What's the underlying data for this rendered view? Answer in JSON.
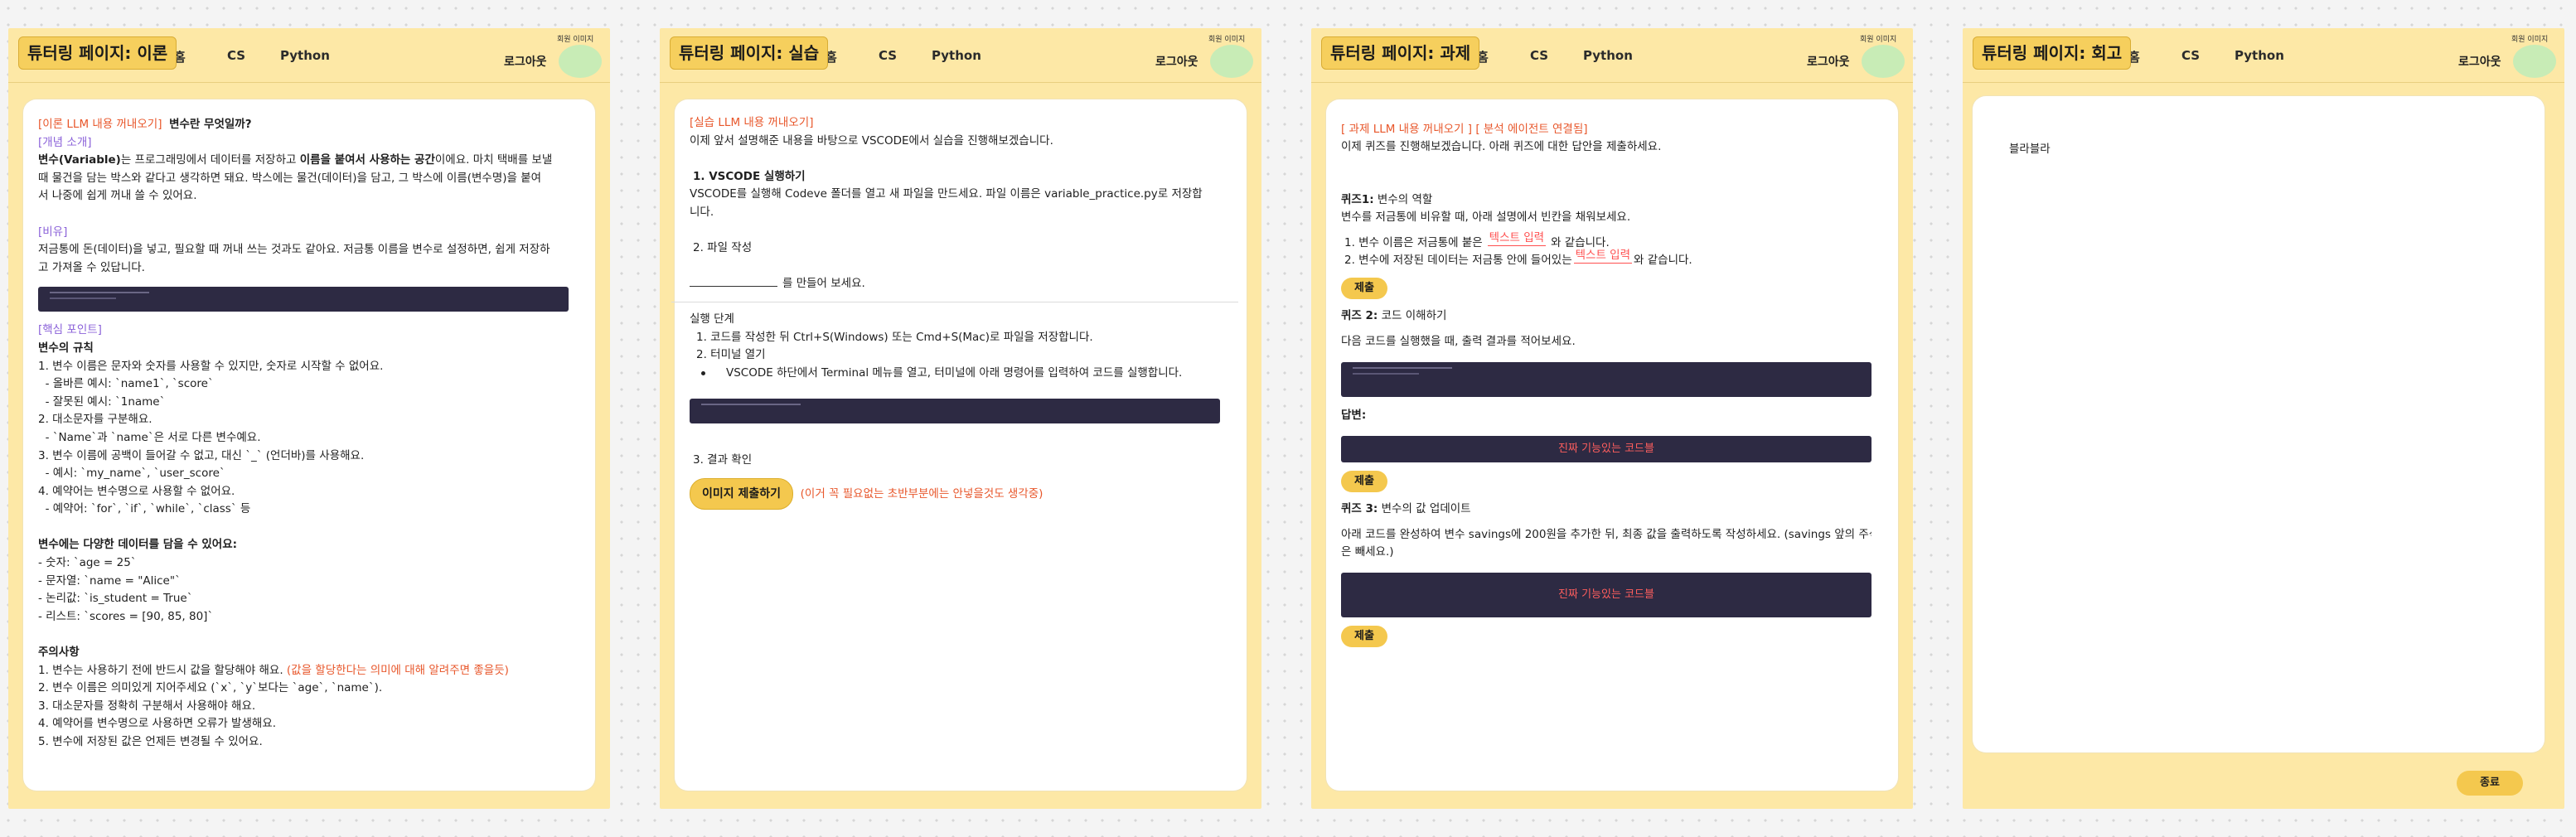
{
  "nav": {
    "stub": "홈",
    "cs": "CS",
    "python": "Python",
    "logout": "로그아웃",
    "avatar_label": "회원 이미지"
  },
  "pages": {
    "theory": {
      "title": "튜터링 페이지: 이론",
      "lines": {
        "l1a": "[이론 LLM 내용 꺼내오기]",
        "l1b": "변수란 무엇일까?",
        "l2": "[개념 소개]",
        "l3a": "변수(Variable)",
        "l3b": "는 프로그래밍에서 데이터를 저장하고 ",
        "l3c": "이름을 붙여서 사용하는 공간",
        "l3d": "이에요. 마치 택배를 보낼",
        "l4": "때 물건을 담는 박스와 같다고 생각하면 돼요. 박스에는 물건(데이터)을 담고, 그 박스에 이름(변수명)을 붙여",
        "l5": "서 나중에 쉽게 꺼내 쓸 수 있어요.",
        "l6": "[비유]",
        "l7": "저금통에 돈(데이터)을 넣고, 필요할 때 꺼내 쓰는 것과도 같아요. 저금통 이름을 변수로 설정하면, 쉽게 저장하",
        "l8": "고 가져올 수 있답니다.",
        "l9": "[핵심 포인트]",
        "l10": "변수의 규칙",
        "l11": "1. 변수 이름은 문자와 숫자를 사용할 수 있지만, 숫자로 시작할 수 없어요.",
        "l12": "  - 올바른 예시: `name1`, `score`",
        "l13": "  - 잘못된 예시: `1name`",
        "l14": "2. 대소문자를 구분해요.",
        "l15": "  - `Name`과 `name`은 서로 다른 변수예요.",
        "l16": "3. 변수 이름에 공백이 들어갈 수 없고, 대신 `_` (언더바)를 사용해요.",
        "l17": "  - 예시: `my_name`, `user_score`",
        "l18": "4. 예약어는 변수명으로 사용할 수 없어요.",
        "l19": "  - 예약어: `for`, `if`, `while`, `class` 등",
        "l20": "변수에는 다양한 데이터를 담을 수 있어요:",
        "l21": "- 숫자: `age = 25`",
        "l22": "- 문자열: `name = \"Alice\"`",
        "l23": "- 논리값: `is_student = True`",
        "l24": "- 리스트: `scores = [90, 85, 80]`",
        "l25": "주의사항",
        "l26a": "1. 변수는 사용하기 전에 반드시 값을 할당해야 해요. ",
        "l26b": "(값을 할당한다는 의미에 대해 알려주면 좋을듯)",
        "l27": "2. 변수 이름은 의미있게 지어주세요 (`x`, `y`보다는 `age`, `name`).",
        "l28": "3. 대소문자를 정확히 구분해서 사용해야 해요.",
        "l29": "4. 예약어를 변수명으로 사용하면 오류가 발생해요.",
        "l30": "5. 변수에 저장된 값은 언제든 변경될 수 있어요."
      }
    },
    "practice": {
      "title": "튜터링 페이지: 실습",
      "lines": {
        "l1": "[실습 LLM 내용 꺼내오기]",
        "l2": "이제 앞서 설명해준 내용을 바탕으로 VSCODE에서 실습을 진행해보겠습니다.",
        "l3": "1. VSCODE 실행하기",
        "l4": "VSCODE를 실행해 Codeve 폴더를 열고 새 파일을 만드세요. 파일 이름은 variable_practice.py로 저장합",
        "l5": "니다.",
        "l6": "2. 파일 작성",
        "l7": "를 만들어 보세요.",
        "l8": "실행 단계",
        "l9": "1. 코드를 작성한 뒤 Ctrl+S(Windows) 또는 Cmd+S(Mac)로 파일을 저장합니다.",
        "l10": "2. 터미널 열기",
        "l11": "VSCODE 하단에서 Terminal 메뉴를 열고, 터미널에 아래 명령어를 입력하여 코드를 실행합니다.",
        "l12": "3. 결과 확인",
        "submit_image": "이미지 제출하기",
        "note": "(이거 꼭 필요없는 초반부분에는 안넣을것도 생각중)"
      }
    },
    "assignment": {
      "title": "튜터링 페이지: 과제",
      "lines": {
        "l1": "[ 과제 LLM 내용 꺼내오기 ] [ 분석 에이전트 연결됨]",
        "l2": "이제 퀴즈를 진행해보겠습니다. 아래 퀴즈에 대한 답안을 제출하세요.",
        "q1_label": "퀴즈1:",
        "q1_title": " 변수의 역할",
        "q1_desc": "변수를 저금통에 비유할 때, 아래 설명에서 빈칸을 채워보세요.",
        "q1_a": "1. 변수 이름은 저금통에 붙은",
        "q1_a2": "와 같습니다.",
        "q1_b": "2. 변수에 저장된 데이터는 저금통 안에 들어있는",
        "q1_b2": "와 같습니다.",
        "text_input": "텍스트 입력",
        "submit": "제출",
        "q2_label": "퀴즈 2:",
        "q2_title": " 코드 이해하기",
        "q2_desc": "다음 코드를 실행했을 때, 출력 결과를 적어보세요.",
        "answer_label": "답변:",
        "working_code": "진짜 기능있는 코드블",
        "q3_label": "퀴즈 3:",
        "q3_title": " 변수의 값 업데이트",
        "q3_desc1": "아래 코드를 완성하여 변수 savings에 200원을 추가한 뒤, 최종 값을 출력하도록 작성하세요. (savings 앞의 주석",
        "q3_desc2": "은 빼세요.)"
      }
    },
    "review": {
      "title": "튜터링 페이지: 회고",
      "body": "블라블라",
      "end_button": "종료"
    }
  }
}
